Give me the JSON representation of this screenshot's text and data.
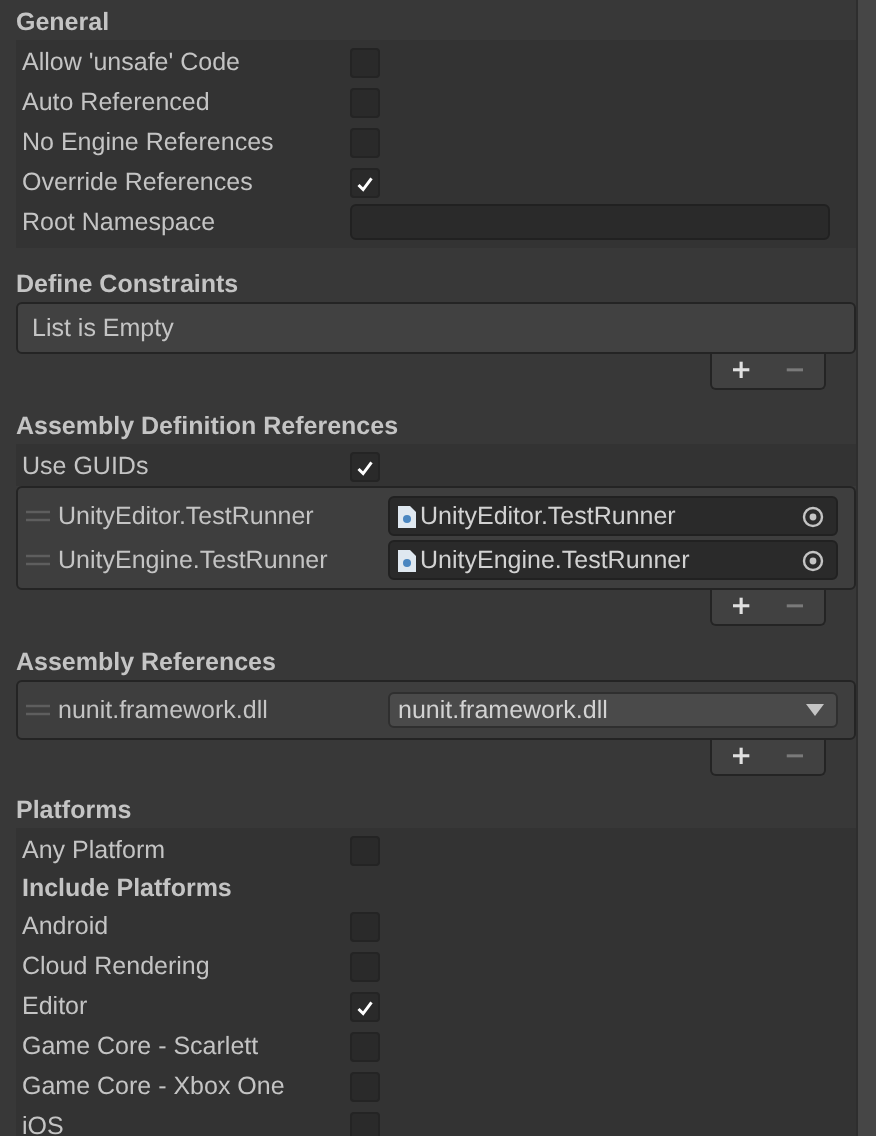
{
  "general": {
    "title": "General",
    "fields": [
      {
        "label": "Allow 'unsafe' Code",
        "kind": "checkbox",
        "checked": false
      },
      {
        "label": "Auto Referenced",
        "kind": "checkbox",
        "checked": false
      },
      {
        "label": "No Engine References",
        "kind": "checkbox",
        "checked": false
      },
      {
        "label": "Override References",
        "kind": "checkbox",
        "checked": true
      },
      {
        "label": "Root Namespace",
        "kind": "text"
      }
    ]
  },
  "define_constraints": {
    "title": "Define Constraints",
    "empty_text": "List is Empty",
    "add": "+",
    "remove": "−"
  },
  "assembly_definition_references": {
    "title": "Assembly Definition References",
    "use_guids": {
      "label": "Use GUIDs",
      "checked": true
    },
    "items": [
      {
        "name": "UnityEditor.TestRunner",
        "reference": "UnityEditor.TestRunner"
      },
      {
        "name": "UnityEngine.TestRunner",
        "reference": "UnityEngine.TestRunner"
      }
    ],
    "add": "+",
    "remove": "−"
  },
  "assembly_references": {
    "title": "Assembly References",
    "items": [
      {
        "name": "nunit.framework.dll",
        "value": "nunit.framework.dll"
      }
    ],
    "add": "+",
    "remove": "−"
  },
  "platforms": {
    "title": "Platforms",
    "any_platform": {
      "label": "Any Platform",
      "checked": false
    },
    "include_title": "Include Platforms",
    "items": [
      {
        "label": "Android",
        "checked": false
      },
      {
        "label": "Cloud Rendering",
        "checked": false
      },
      {
        "label": "Editor",
        "checked": true
      },
      {
        "label": "Game Core - Scarlett",
        "checked": false
      },
      {
        "label": "Game Core - Xbox One",
        "checked": false
      },
      {
        "label": "iOS",
        "checked": false
      }
    ]
  }
}
